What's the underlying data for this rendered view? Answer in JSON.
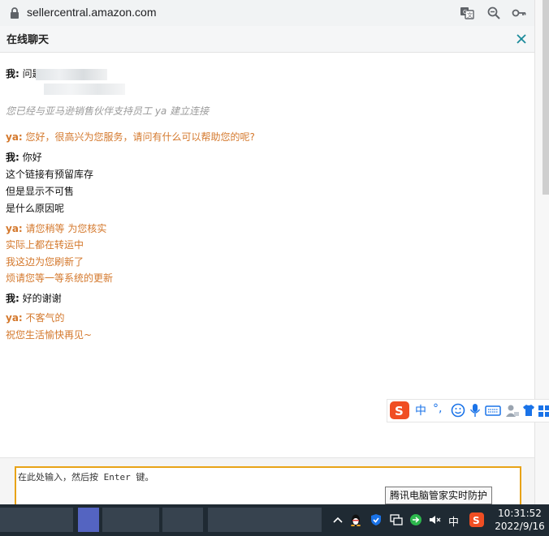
{
  "browser": {
    "url": "sellercentral.amazon.com"
  },
  "chat": {
    "title": "在线聊天",
    "messages": [
      {
        "speaker": "我:",
        "lines": [
          "问题"
        ]
      },
      {
        "system": "您已经与亚马逊销售伙伴支持员工 ya 建立连接"
      },
      {
        "speaker": "ya:",
        "lines": [
          "您好，很高兴为您服务，请问有什么可以帮助您的呢?"
        ]
      },
      {
        "speaker": "我:",
        "lines": [
          "你好",
          "这个链接有预留库存",
          "但是显示不可售",
          "是什么原因呢"
        ]
      },
      {
        "speaker": "ya:",
        "lines": [
          "请您稍等 为您核实",
          "实际上都在转运中",
          "我这边为您刷新了",
          "烦请您等一等系统的更新"
        ]
      },
      {
        "speaker": "我:",
        "lines": [
          "好的谢谢"
        ]
      },
      {
        "speaker": "ya:",
        "lines": [
          "不客气的",
          "祝您生活愉快再见~"
        ]
      }
    ],
    "input_placeholder": "在此处输入，然后按 Enter 键。"
  },
  "ime": {
    "mode": "中",
    "punct": "°,"
  },
  "tooltip": "腾讯电脑管家实时防护",
  "taskbar": {
    "ime_mode": "中",
    "time": "10:31:52",
    "date": "2022/9/16"
  },
  "colors": {
    "agent": "#d4782c",
    "input_border": "#e8a317",
    "close": "#1a8a9a"
  }
}
